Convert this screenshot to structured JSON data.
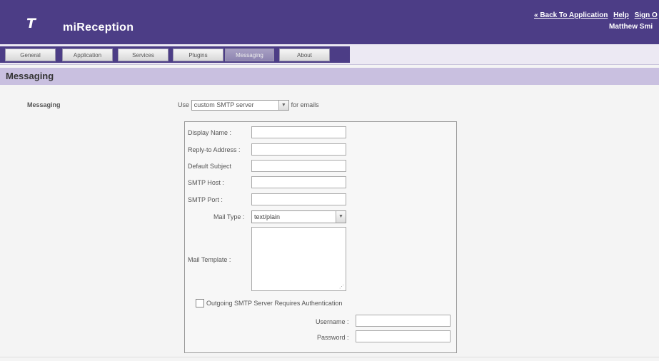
{
  "header": {
    "logo": "T",
    "title": "miReception",
    "links": [
      "« Back To Application",
      "Help",
      "Sign O"
    ],
    "user": "Matthew Smi",
    "bg_color": "#4c3d86"
  },
  "tabs": [
    {
      "label": "General"
    },
    {
      "label": "Application"
    },
    {
      "label": "Services"
    },
    {
      "label": "Plugins"
    },
    {
      "label": "Messaging",
      "active": true
    },
    {
      "label": "About"
    }
  ],
  "section": {
    "title": "Messaging"
  },
  "messaging": {
    "label": "Messaging",
    "use_prefix": "Use",
    "server_value": "custom SMTP server",
    "use_suffix": "for emails"
  },
  "form": {
    "display_name": {
      "label": "Display Name :",
      "value": ""
    },
    "reply_to": {
      "label": "Reply-to Address :",
      "value": ""
    },
    "default_subject": {
      "label": "Default Subject",
      "value": ""
    },
    "smtp_host": {
      "label": "SMTP Host :",
      "value": ""
    },
    "smtp_port": {
      "label": "SMTP Port :",
      "value": ""
    },
    "mail_type": {
      "label": "Mail Type :",
      "value": "text/plain"
    },
    "mail_template": {
      "label": "Mail Template :",
      "value": ""
    },
    "auth": {
      "label": "Outgoing SMTP Server Requires Authentication",
      "checked": false
    },
    "username": {
      "label": "Username :",
      "value": ""
    },
    "password": {
      "label": "Password :",
      "value": ""
    }
  }
}
